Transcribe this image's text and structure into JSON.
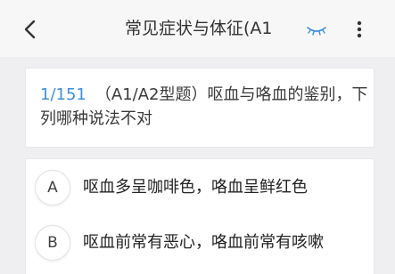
{
  "nav": {
    "title": "常见症状与体征(A1",
    "back_icon": "chevron-left-icon",
    "eye_icon": "eye-closed-icon",
    "more_icon": "vertical-dots-icon",
    "accent": "#3d8fe0"
  },
  "question": {
    "index": "1/151",
    "text": "（A1/A2型题）呕血与咯血的鉴别，下列哪种说法不对"
  },
  "options": [
    {
      "letter": "A",
      "text": "呕血多呈咖啡色，咯血呈鲜红色"
    },
    {
      "letter": "B",
      "text": "呕血前常有恶心，咯血前常有咳嗽"
    }
  ]
}
